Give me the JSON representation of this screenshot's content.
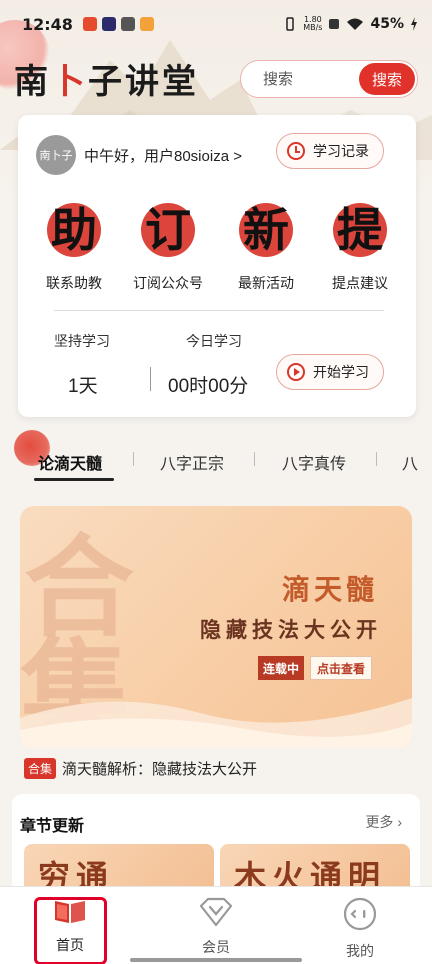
{
  "status_bar": {
    "time": "12:48",
    "network_speed_value": "1.80",
    "network_speed_unit": "MB/s",
    "battery": "45%"
  },
  "header": {
    "logo_left": "南",
    "logo_red": "卜",
    "logo_right": "子讲堂",
    "search_placeholder": "搜索",
    "search_button": "搜索"
  },
  "user_card": {
    "avatar_text": "南卜子",
    "greeting": "中午好，用户80sioiza >",
    "history_button": "学习记录",
    "quick_actions": [
      {
        "glyph": "助",
        "label": "联系助教"
      },
      {
        "glyph": "订",
        "label": "订阅公众号"
      },
      {
        "glyph": "新",
        "label": "最新活动"
      },
      {
        "glyph": "提",
        "label": "提点建议"
      }
    ],
    "stats": {
      "persist_label": "坚持学习",
      "persist_value": "1天",
      "today_label": "今日学习",
      "today_value": "00时00分"
    },
    "start_button": "开始学习"
  },
  "tabs": [
    "论滴天髓",
    "八字正宗",
    "八字真传",
    "八"
  ],
  "banner": {
    "bg_chars": [
      "合",
      "集"
    ],
    "title1": "滴天髓",
    "title2": "隐藏技法大公开",
    "tag_left": "连载中",
    "tag_right": "点击查看"
  },
  "caption": {
    "badge": "合集",
    "text": "滴天髓解析：隐藏技法大公开"
  },
  "chapter": {
    "heading": "章节更新",
    "more": "更多 ›",
    "thumbs": [
      "穷通",
      "木火通明"
    ]
  },
  "bottom_nav": {
    "home": "首页",
    "member": "会员",
    "mine": "我的"
  }
}
